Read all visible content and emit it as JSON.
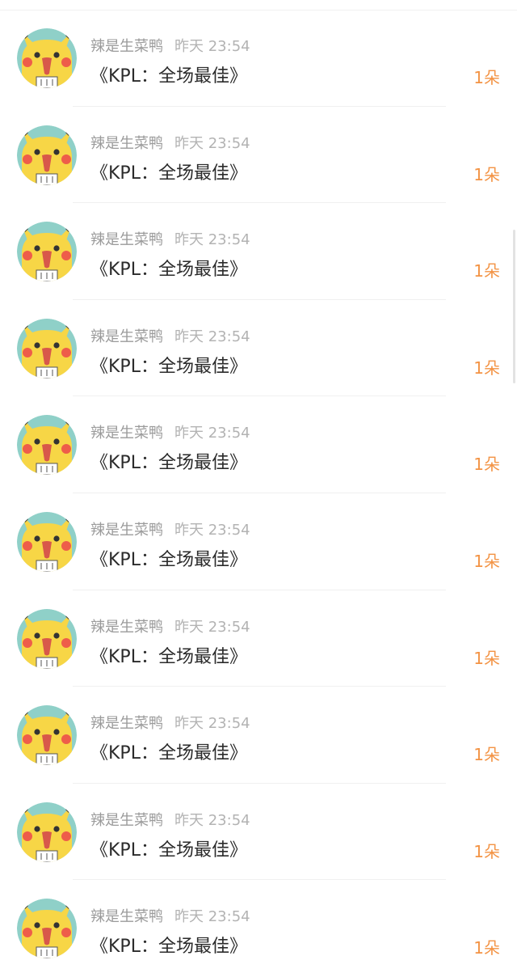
{
  "colors": {
    "accent": "#f39344",
    "name_gray": "#9b9b9b",
    "time_gray": "#b3b3b3",
    "title_dark": "#2b2b2b",
    "avatar_bg": "#8fd0c8",
    "avatar_face": "#f7d646"
  },
  "gifts": {
    "items": [
      {
        "name": "辣是生菜鸭",
        "time": "昨天 23:54",
        "gift": "《KPL：全场最佳》",
        "count": "1朵",
        "avatar_icon": "pikachu-avatar"
      },
      {
        "name": "辣是生菜鸭",
        "time": "昨天 23:54",
        "gift": "《KPL：全场最佳》",
        "count": "1朵",
        "avatar_icon": "pikachu-avatar"
      },
      {
        "name": "辣是生菜鸭",
        "time": "昨天 23:54",
        "gift": "《KPL：全场最佳》",
        "count": "1朵",
        "avatar_icon": "pikachu-avatar"
      },
      {
        "name": "辣是生菜鸭",
        "time": "昨天 23:54",
        "gift": "《KPL：全场最佳》",
        "count": "1朵",
        "avatar_icon": "pikachu-avatar"
      },
      {
        "name": "辣是生菜鸭",
        "time": "昨天 23:54",
        "gift": "《KPL：全场最佳》",
        "count": "1朵",
        "avatar_icon": "pikachu-avatar"
      },
      {
        "name": "辣是生菜鸭",
        "time": "昨天 23:54",
        "gift": "《KPL：全场最佳》",
        "count": "1朵",
        "avatar_icon": "pikachu-avatar"
      },
      {
        "name": "辣是生菜鸭",
        "time": "昨天 23:54",
        "gift": "《KPL：全场最佳》",
        "count": "1朵",
        "avatar_icon": "pikachu-avatar"
      },
      {
        "name": "辣是生菜鸭",
        "time": "昨天 23:54",
        "gift": "《KPL：全场最佳》",
        "count": "1朵",
        "avatar_icon": "pikachu-avatar"
      },
      {
        "name": "辣是生菜鸭",
        "time": "昨天 23:54",
        "gift": "《KPL：全场最佳》",
        "count": "1朵",
        "avatar_icon": "pikachu-avatar"
      },
      {
        "name": "辣是生菜鸭",
        "time": "昨天 23:54",
        "gift": "《KPL：全场最佳》",
        "count": "1朵",
        "avatar_icon": "pikachu-avatar"
      }
    ]
  }
}
